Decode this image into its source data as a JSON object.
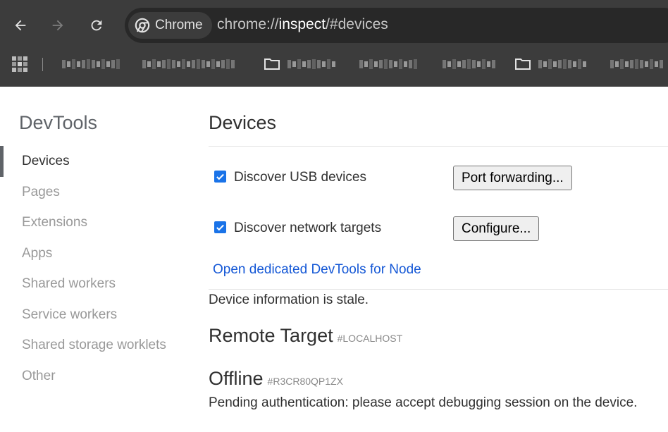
{
  "browser": {
    "chip_label": "Chrome",
    "url_scheme": "chrome://",
    "url_host": "inspect",
    "url_path": "/#devices",
    "nav": {
      "back": "arrow-left-icon",
      "forward": "arrow-right-icon",
      "reload": "reload-icon"
    }
  },
  "bookmarks": {
    "items": [
      {
        "icon": "page-icon",
        "blurred": true
      },
      {
        "icon": "page-icon",
        "blurred": true
      },
      {
        "icon": "folder-icon",
        "blurred": true
      },
      {
        "icon": "page-icon",
        "blurred": true
      },
      {
        "icon": "page-icon",
        "blurred": true
      },
      {
        "icon": "folder-icon",
        "blurred": true
      },
      {
        "icon": "page-icon",
        "blurred": true
      }
    ]
  },
  "sidebar": {
    "title": "DevTools",
    "items": [
      {
        "label": "Devices",
        "active": true
      },
      {
        "label": "Pages"
      },
      {
        "label": "Extensions"
      },
      {
        "label": "Apps"
      },
      {
        "label": "Shared workers"
      },
      {
        "label": "Service workers"
      },
      {
        "label": "Shared storage worklets"
      },
      {
        "label": "Other"
      }
    ]
  },
  "main": {
    "title": "Devices",
    "discover_usb": {
      "label": "Discover USB devices",
      "checked": true,
      "button": "Port forwarding..."
    },
    "discover_network": {
      "label": "Discover network targets",
      "checked": true,
      "button": "Configure..."
    },
    "node_link": "Open dedicated DevTools for Node",
    "stale_text": "Device information is stale.",
    "remote_target": {
      "title": "Remote Target",
      "tag": "#LOCALHOST"
    },
    "offline": {
      "title": "Offline",
      "tag": "#R3CR80QP1ZX"
    },
    "pending_text": "Pending authentication: please accept debugging session on the device."
  },
  "colors": {
    "accent": "#1a73e8",
    "link": "#1558d6",
    "toolbar": "#3c3c3c"
  }
}
